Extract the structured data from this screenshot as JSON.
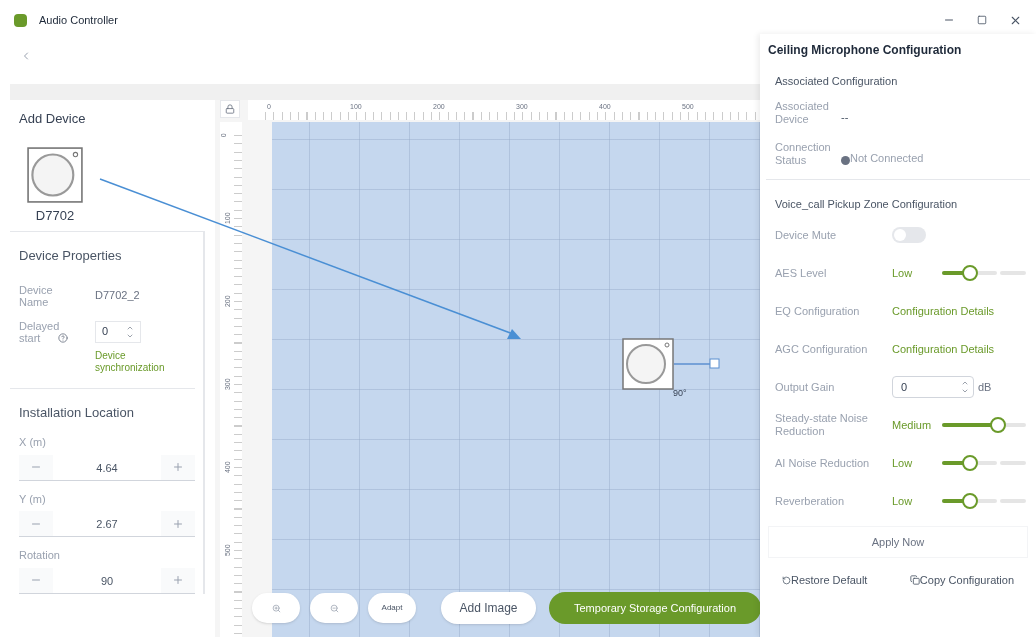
{
  "window": {
    "title": "Audio Controller"
  },
  "left_panel": {
    "add_device_title": "Add Device",
    "device_label": "D7702",
    "properties_title": "Device Properties",
    "device_name_label": "Device Name",
    "device_name": "D7702_2",
    "delayed_start_label": "Delayed start",
    "delayed_start_value": "0",
    "sync_link": "Device synchronization",
    "location_title": "Installation Location",
    "steppers": [
      {
        "label": "X (m)",
        "value": "4.64"
      },
      {
        "label": "Y (m)",
        "value": "2.67"
      },
      {
        "label": "Rotation",
        "value": "90"
      }
    ]
  },
  "canvas": {
    "top_ruler": [
      "0",
      "100",
      "200",
      "300",
      "400",
      "500"
    ],
    "left_ruler": [
      "0",
      "100",
      "200",
      "300",
      "400",
      "500"
    ],
    "device_rotation": "90°",
    "toolbar": [
      {
        "kind": "zoom_in"
      },
      {
        "kind": "zoom_out"
      },
      {
        "kind": "text",
        "label": "Adapt"
      }
    ],
    "add_image": "Add Image",
    "storage_button": "Temporary Storage Configuration"
  },
  "right_panel": {
    "title": "Ceiling Microphone Configuration",
    "associated_title": "Associated Configuration",
    "associated_device_label": "Associated Device",
    "associated_device": "--",
    "connection_label": "Connection Status",
    "connection_status": "Not Connected",
    "pickup_title": "Voice_call Pickup Zone Configuration",
    "settings": [
      {
        "kind": "toggle",
        "label": "Device Mute",
        "on": false
      },
      {
        "kind": "slider",
        "label": "AES Level",
        "value_label": "Low",
        "level": 0.33
      },
      {
        "kind": "link",
        "label": "EQ Configuration",
        "link": "Configuration Details"
      },
      {
        "kind": "link",
        "label": "AGC Configuration",
        "link": "Configuration Details"
      },
      {
        "kind": "number",
        "label": "Output Gain",
        "value": "0",
        "unit": "dB"
      },
      {
        "kind": "slider",
        "label": "Steady-state Noise Reduction",
        "value_label": "Medium",
        "level": 0.67
      },
      {
        "kind": "slider",
        "label": "AI Noise Reduction",
        "value_label": "Low",
        "level": 0.33
      },
      {
        "kind": "slider",
        "label": "Reverberation",
        "value_label": "Low",
        "level": 0.33
      }
    ],
    "apply_button": {
      "label": "Apply Now",
      "disabled": true
    },
    "restore_button": "Restore Default",
    "copy_button": "Copy Configuration"
  }
}
